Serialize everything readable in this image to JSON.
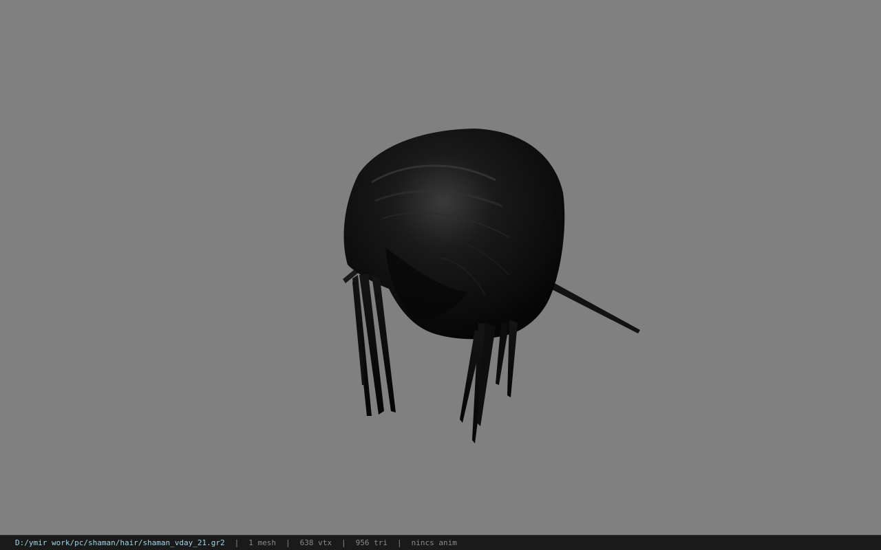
{
  "viewport": {
    "background_color": "#808080",
    "model_color": "#0a0a0a",
    "model_subject": "hair mesh"
  },
  "statusbar": {
    "file_path": "D:/ymir work/pc/shaman/hair/shaman_vday_21.gr2",
    "separator": "|",
    "mesh_count": "1 mesh",
    "vertex_count": "638 vtx",
    "triangle_count": "956 tri",
    "anim_status": "nincs anim",
    "path_color": "#9fd6e6",
    "text_color": "#8a8a8a",
    "background_color": "#1a1a1a"
  }
}
